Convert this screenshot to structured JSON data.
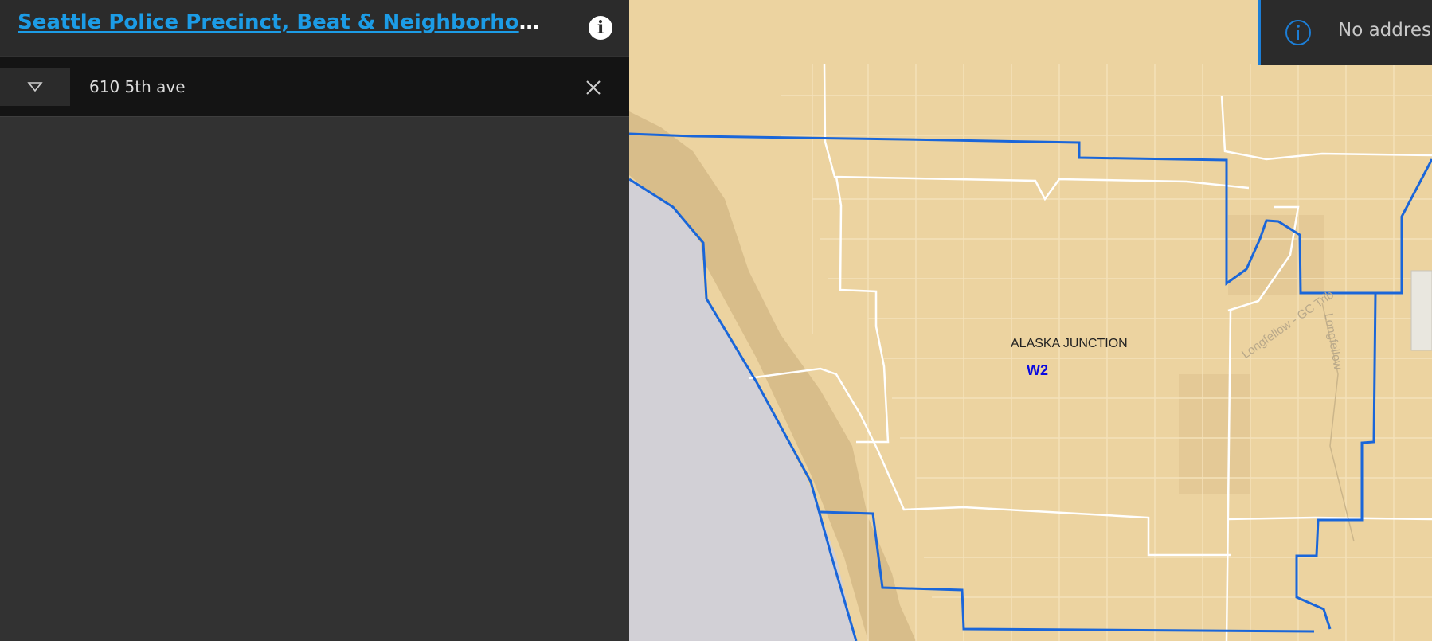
{
  "app": {
    "title": "Seattle Police Precinct, Beat & Neighborhood Lookup",
    "info_icon": "info-icon"
  },
  "search": {
    "value": "610 5th ave",
    "dropdown_icon": "triangle-down-icon",
    "clear_icon": "close-icon"
  },
  "alert": {
    "icon": "info-circle-icon",
    "message": "No address found that meet search criteria"
  },
  "map": {
    "neighborhood_label": "ALASKA JUNCTION",
    "beat_label": "W2",
    "trail_label": "Longfellow - GC Trib",
    "creek_label": "Longfellow",
    "colors": {
      "land": "#ecd3a0",
      "water": "#d2d0d6",
      "shore": "#d8bd8a",
      "boundary": "#1a66d9",
      "streets": "#ffffff"
    }
  }
}
